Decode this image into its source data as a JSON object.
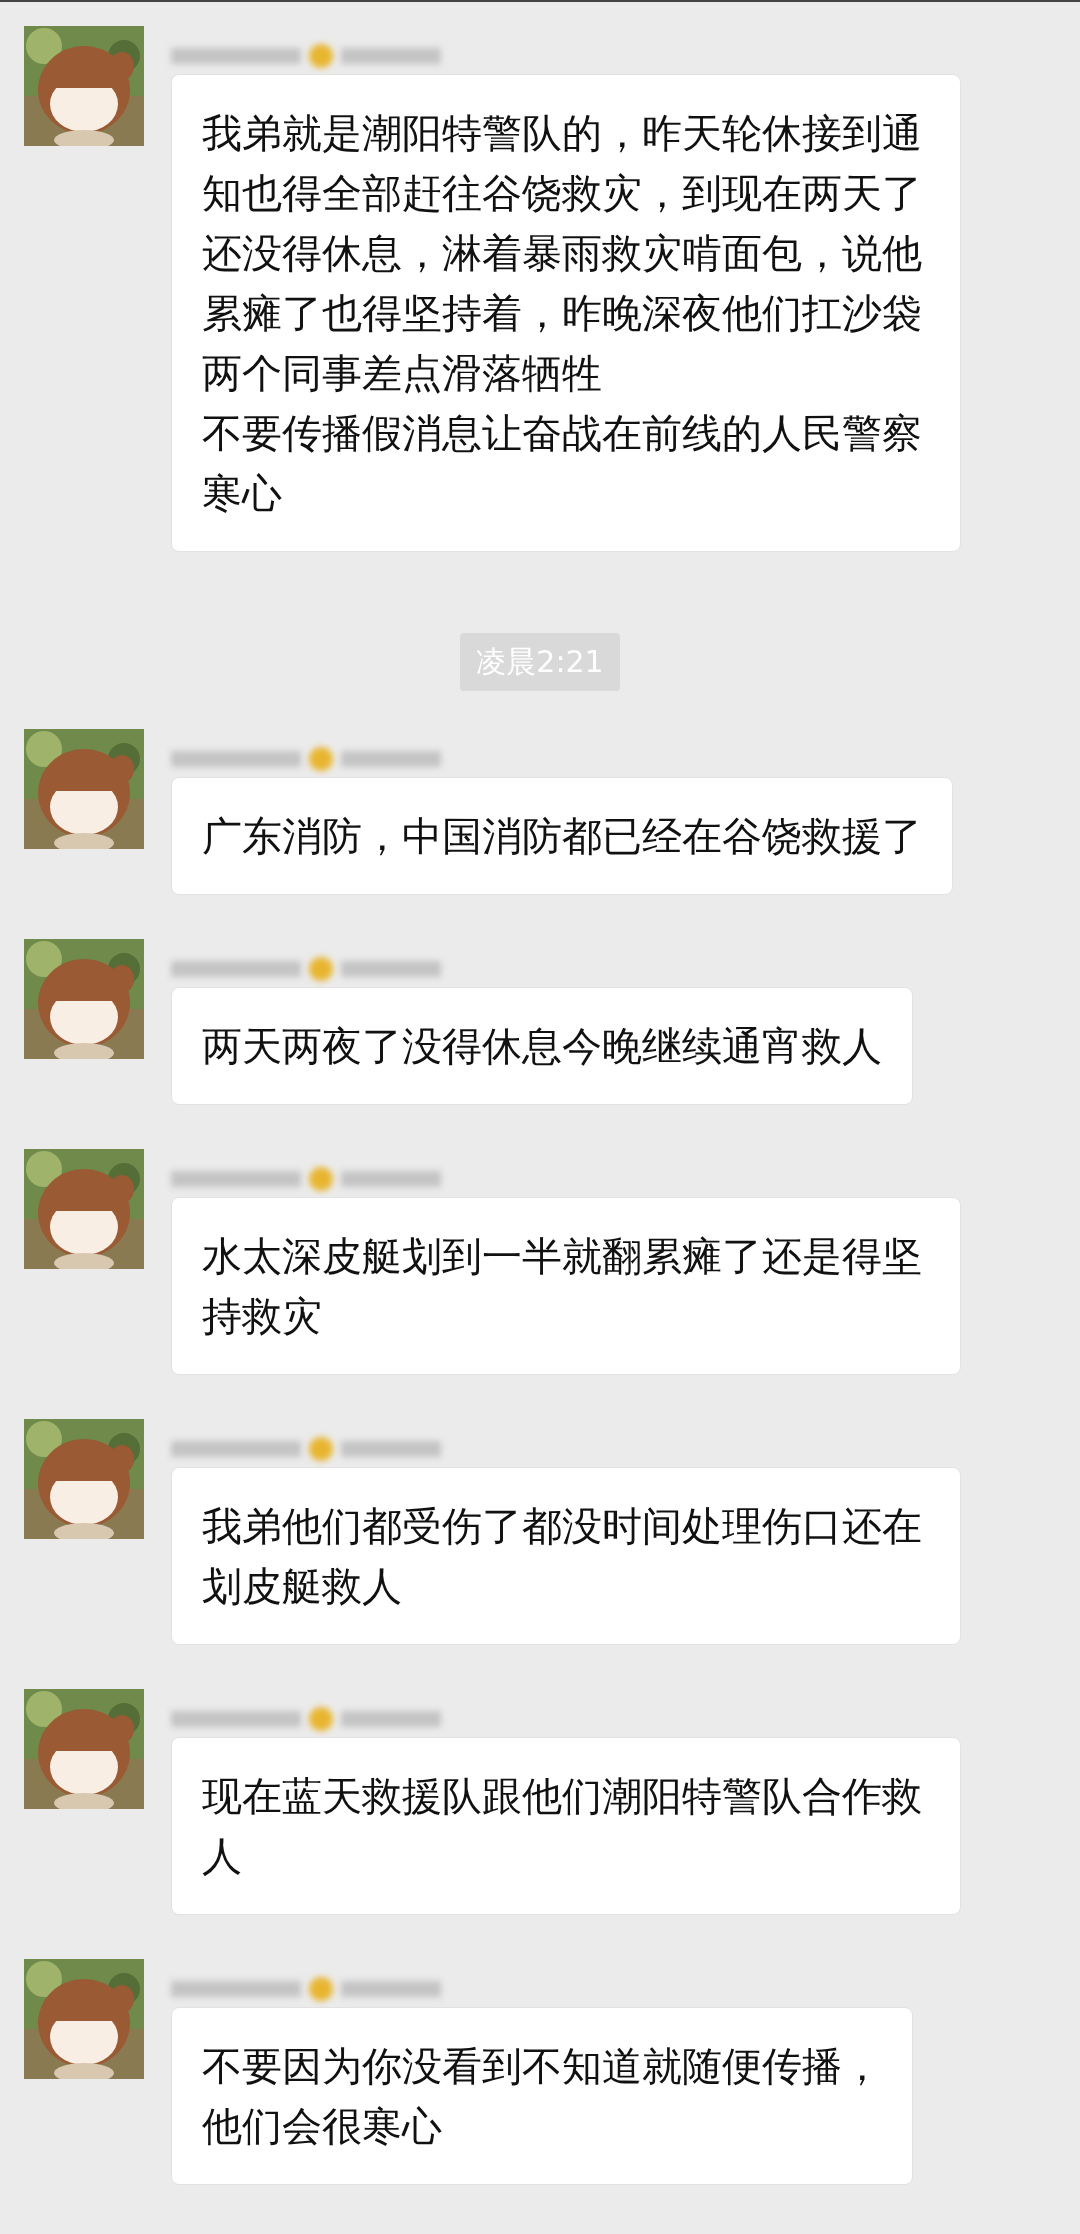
{
  "chat": [
    {
      "kind": "message",
      "text": "我弟就是潮阳特警队的，昨天轮休接到通知也得全部赶往谷饶救灾，到现在两天了还没得休息，淋着暴雨救灾啃面包，说他累瘫了也得坚持着，昨晚深夜他们扛沙袋两个同事差点滑落牺牲",
      "more": [
        "不要传播假消息让奋战在前线的人民警察寒心"
      ]
    },
    {
      "kind": "time",
      "text": "凌晨2:21"
    },
    {
      "kind": "message",
      "text": "广东消防，中国消防都已经在谷饶救援了"
    },
    {
      "kind": "message",
      "text": "两天两夜了没得休息今晚继续通宵救人"
    },
    {
      "kind": "message",
      "text": "水太深皮艇划到一半就翻累瘫了还是得坚持救灾"
    },
    {
      "kind": "message",
      "text": "我弟他们都受伤了都没时间处理伤口还在划皮艇救人"
    },
    {
      "kind": "message",
      "text": "现在蓝天救援队跟他们潮阳特警队合作救人"
    },
    {
      "kind": "message",
      "text": "不要因为你没看到不知道就随便传播，",
      "more": [
        "他们会很寒心"
      ]
    }
  ]
}
